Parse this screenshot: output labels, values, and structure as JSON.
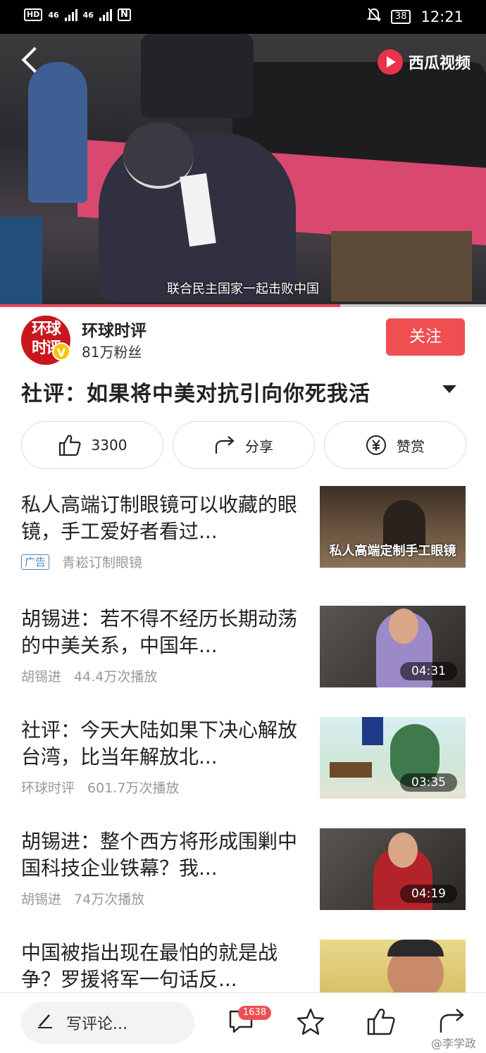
{
  "status_bar": {
    "left_hd": "HD",
    "left_net1": "46",
    "left_net2": "46",
    "left_nfc": "N",
    "battery": "38",
    "time": "12:21"
  },
  "video": {
    "brand": "西瓜视频",
    "subtitle": "联合民主国家一起击败中国",
    "progress_percent": 70
  },
  "author": {
    "avatar_text_1": "环球",
    "avatar_text_2": "时评",
    "verified_mark": "V",
    "name": "环球时评",
    "fans": "81万粉丝",
    "follow_label": "关注"
  },
  "article": {
    "title": "社评：如果将中美对抗引向你死我活"
  },
  "actions": {
    "like_count": "3300",
    "share_label": "分享",
    "reward_label": "赞赏"
  },
  "related": [
    {
      "title": "私人高端订制眼镜可以收藏的眼镜，手工爱好者看过...",
      "ad_tag": "广告",
      "source": "青崧订制眼镜",
      "views": "",
      "duration": "",
      "thumb_caption": "私人高端定制手工眼镜"
    },
    {
      "title": "胡锡进：若不得不经历长期动荡的中美关系，中国年...",
      "ad_tag": "",
      "source": "胡锡进",
      "views": "44.4万次播放",
      "duration": "04:31",
      "thumb_caption": ""
    },
    {
      "title": "社评：今天大陆如果下决心解放台湾，比当年解放北...",
      "ad_tag": "",
      "source": "环球时评",
      "views": "601.7万次播放",
      "duration": "03:35",
      "thumb_caption": ""
    },
    {
      "title": "胡锡进：整个西方将形成围剿中国科技企业铁幕？我...",
      "ad_tag": "",
      "source": "胡锡进",
      "views": "74万次播放",
      "duration": "04:19",
      "thumb_caption": ""
    },
    {
      "title": "中国被指出现在最怕的就是战争？罗援将军一句话反...",
      "ad_tag": "",
      "source": "",
      "views": "",
      "duration": "",
      "thumb_caption": ""
    }
  ],
  "bottom_bar": {
    "comment_placeholder": "写评论...",
    "comment_count": "1638",
    "watermark": "@李学政"
  },
  "colors": {
    "accent": "#f04f52",
    "ad_blue": "#4a86c5",
    "badge_yellow": "#f7c300"
  }
}
